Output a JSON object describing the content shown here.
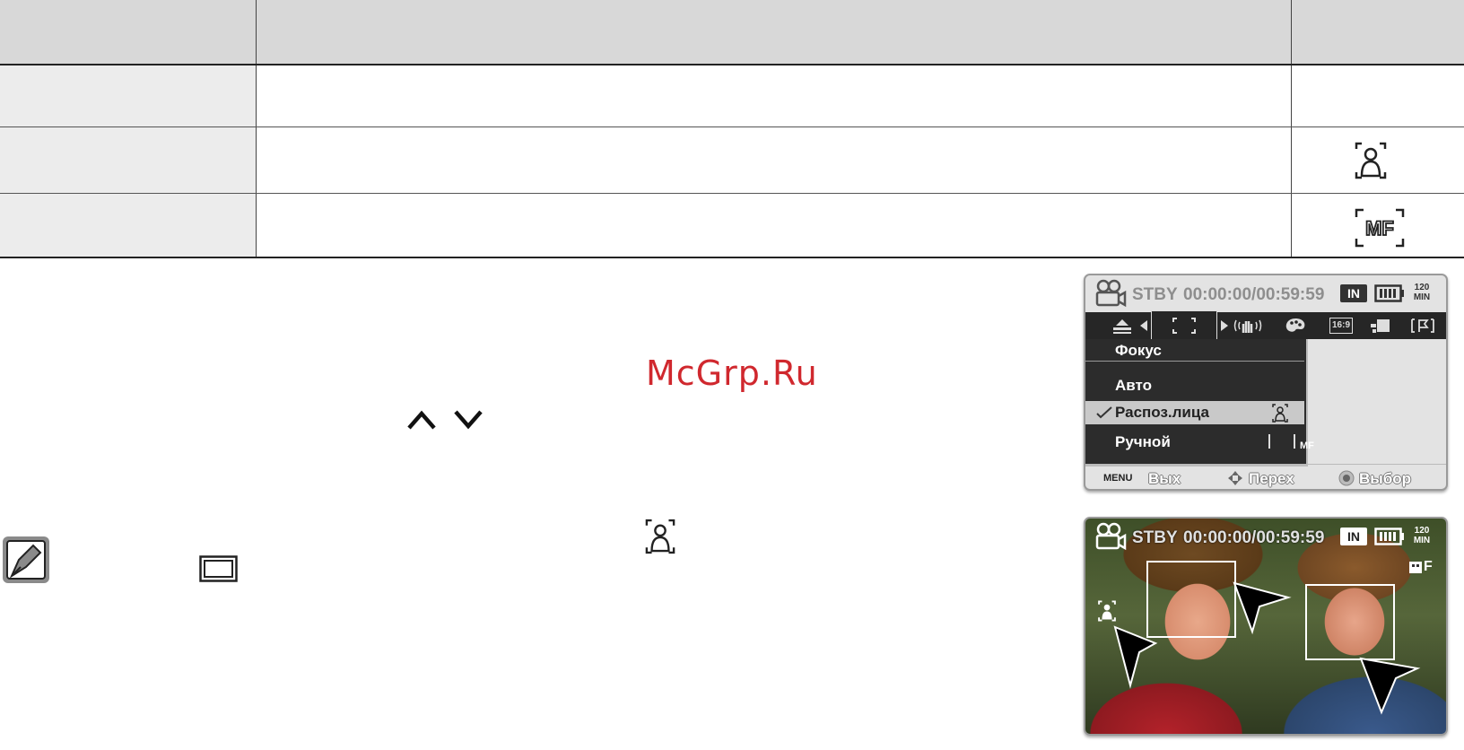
{
  "watermark": "McGrp.Ru",
  "lcd_menu": {
    "status": {
      "mode": "STBY",
      "timecode": "00:00:00/00:59:59",
      "storage": "IN",
      "remaining_top": "120",
      "remaining_bottom": "MIN"
    },
    "tabs": [
      {
        "icon": "scene-icon"
      },
      {
        "icon": "focus-icon",
        "selected": true
      },
      {
        "icon": "anti-shake-icon"
      },
      {
        "icon": "color-palette-icon"
      },
      {
        "icon": "aspect-16-9-icon",
        "label": "16:9"
      },
      {
        "icon": "digital-effect-icon"
      },
      {
        "icon": "flag-icon"
      }
    ],
    "menu": {
      "title": "Фокус",
      "items": [
        {
          "label": "Авто",
          "selected": false
        },
        {
          "label": "Распоз.лица",
          "selected": true,
          "icon": "face-detection-icon"
        },
        {
          "label": "Ручной",
          "selected": false,
          "icon": "manual-focus-icon",
          "icon_text": "MF"
        }
      ]
    },
    "footer": {
      "menu_key": "MENU",
      "exit": "Вых",
      "move": "Перех",
      "select": "Выбор"
    }
  },
  "photo_screen": {
    "status": {
      "mode": "STBY",
      "timecode": "00:00:00/00:59:59",
      "storage": "IN",
      "remaining_top": "120",
      "remaining_bottom": "MIN"
    }
  },
  "colors": {
    "watermark": "#d0282e",
    "table_header": "#d8d8d8",
    "table_first_col": "#ececec",
    "menu_bg": "#2c2c2c"
  }
}
